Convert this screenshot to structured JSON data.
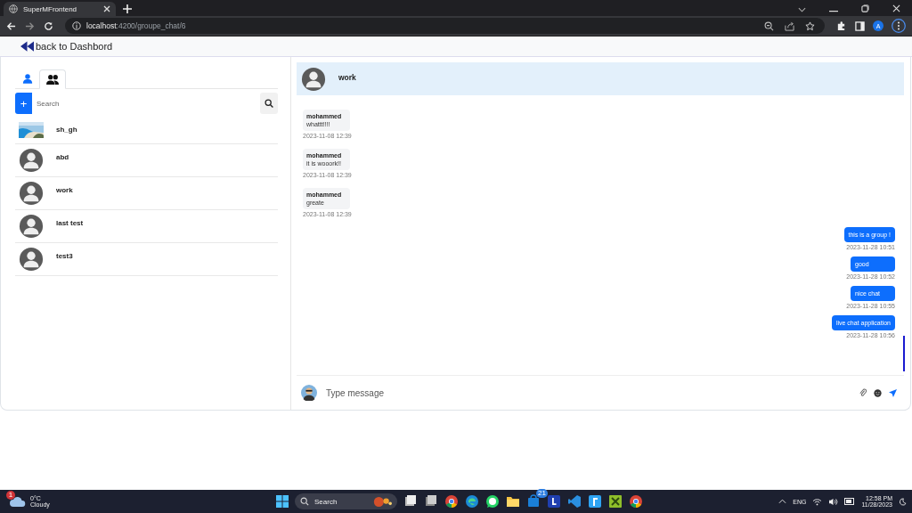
{
  "browser": {
    "tab_title": "SuperMFrontend",
    "url_host": "localhost",
    "url_path": ":4200/groupe_chat/6",
    "profile_initial": "A"
  },
  "nav": {
    "back_label": "back to Dashbord"
  },
  "tabs": [
    {
      "kind": "user",
      "selected": false
    },
    {
      "kind": "group",
      "selected": true
    }
  ],
  "search": {
    "add_label": "+",
    "placeholder": "Search"
  },
  "contacts": [
    {
      "name": "sh_gh",
      "kind": "picture"
    },
    {
      "name": "abd",
      "kind": "avatar"
    },
    {
      "name": "work",
      "kind": "avatar"
    },
    {
      "name": "last test",
      "kind": "avatar"
    },
    {
      "name": "test3",
      "kind": "avatar"
    }
  ],
  "chat": {
    "title": "work"
  },
  "messages": [
    {
      "kind": "incoming",
      "sender": "mohammed",
      "text": "whattt!!!!",
      "time": "2023-11-08 12:39"
    },
    {
      "kind": "incoming",
      "sender": "mohammed",
      "text": "it is wooork!!",
      "time": "2023-11-08 12:39"
    },
    {
      "kind": "incoming",
      "sender": "mohammed",
      "text": "greate",
      "time": "2023-11-08 12:39"
    },
    {
      "kind": "outgoing",
      "text": "this is a group !",
      "time": "2023-11-28 10:51"
    },
    {
      "kind": "outgoing",
      "text": "good",
      "time": "2023-11-28 10:52"
    },
    {
      "kind": "outgoing",
      "text": "nice chat",
      "time": "2023-11-28 10:55"
    },
    {
      "kind": "outgoing",
      "text": "live chat application",
      "time": "2023-11-28 10:56"
    }
  ],
  "composer": {
    "placeholder": "Type message"
  },
  "taskbar": {
    "alert": "1",
    "temperature": "0°C",
    "condition": "Cloudy",
    "search": "Search",
    "apps": [
      {
        "kind": "widget"
      },
      {
        "kind": "files"
      },
      {
        "kind": "chrome"
      },
      {
        "kind": "edge"
      },
      {
        "kind": "whatsapp"
      },
      {
        "kind": "folder"
      },
      {
        "kind": "store",
        "badge": "21"
      },
      {
        "kind": "letter"
      },
      {
        "kind": "code"
      },
      {
        "kind": "app"
      },
      {
        "kind": "app2"
      },
      {
        "kind": "chrome"
      }
    ],
    "language": "ENG",
    "time": "12:58 PM",
    "date": "11/28/2023"
  }
}
